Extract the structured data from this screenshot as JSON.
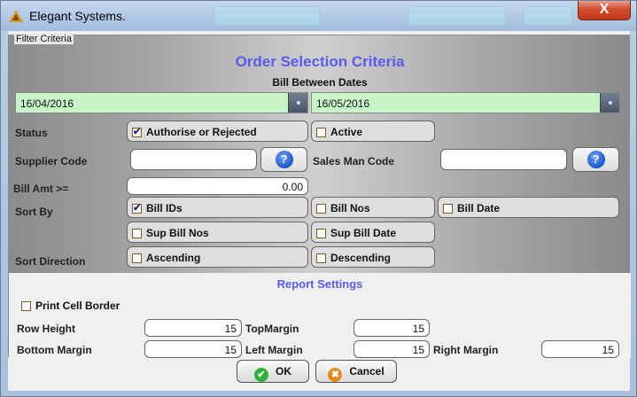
{
  "window": {
    "title": "Elegant Systems."
  },
  "titlebar": {
    "close_glyph": "X"
  },
  "filter": {
    "legend": "Filter Criteria",
    "heading": "Order Selection Criteria",
    "subheading": "Bill Between Dates",
    "date_from": "16/04/2016",
    "date_to": "16/05/2016",
    "status_label": "Status",
    "status_options": [
      {
        "label": "Authorise or Rejected",
        "checked": true
      },
      {
        "label": "Active",
        "checked": false
      }
    ],
    "supplier_code_label": "Supplier Code",
    "supplier_code_value": "",
    "sales_man_code_label": "Sales Man Code",
    "sales_man_code_value": "",
    "help_glyph": "?",
    "bill_amt_label": "Bill Amt  >=",
    "bill_amt_value": "0.00",
    "sort_by_label": "Sort By",
    "sort_by_options": [
      {
        "label": "Bill IDs",
        "checked": true
      },
      {
        "label": "Bill Nos",
        "checked": false
      },
      {
        "label": "Bill Date",
        "checked": false
      },
      {
        "label": "Sup Bill Nos",
        "checked": false
      },
      {
        "label": "Sup Bill Date",
        "checked": false
      }
    ],
    "sort_direction_label": "Sort Direction",
    "sort_direction_options": [
      {
        "label": "Ascending",
        "checked": false
      },
      {
        "label": "Descending",
        "checked": false
      }
    ]
  },
  "report": {
    "heading": "Report Settings",
    "print_cell_border_label": "Print Cell Border",
    "print_cell_border_checked": false,
    "row_height_label": "Row Height",
    "row_height_value": "15",
    "top_margin_label": "TopMargin",
    "top_margin_value": "15",
    "bottom_margin_label": "Bottom Margin",
    "bottom_margin_value": "15",
    "left_margin_label": "Left Margin",
    "left_margin_value": "15",
    "right_margin_label": "Right Margin",
    "right_margin_value": "15"
  },
  "footer": {
    "ok_label": "OK",
    "cancel_label": "Cancel"
  },
  "colors": {
    "heading": "#5a5af0",
    "date_field": "#c8f5c8",
    "close_button": "#d34b2c"
  },
  "icons": [
    "app-logo-icon",
    "calendar-icon",
    "help-icon",
    "ok-check-icon",
    "cancel-icon",
    "checkbox-icon"
  ]
}
